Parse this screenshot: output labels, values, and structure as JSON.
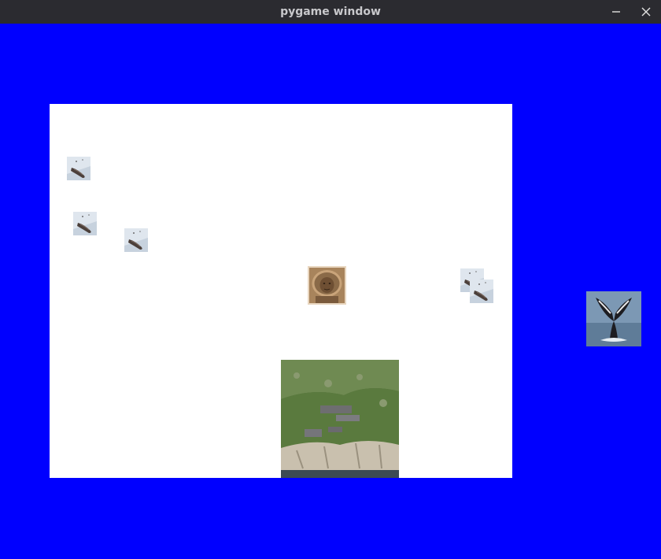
{
  "window": {
    "title": "pygame window",
    "background_color": "#0000ff",
    "titlebar_color": "#2b2b30"
  },
  "titlebar": {
    "minimize_icon": "minimize-icon",
    "close_icon": "close-icon"
  },
  "scene": {
    "panel_color": "#ffffff",
    "sprites": [
      {
        "kind": "seal-on-ice"
      },
      {
        "kind": "seal-on-ice"
      },
      {
        "kind": "seal-on-ice"
      },
      {
        "kind": "seal-on-ice"
      },
      {
        "kind": "seal-on-ice"
      },
      {
        "kind": "sepia-portrait"
      },
      {
        "kind": "island-cliff"
      },
      {
        "kind": "whale-tail"
      }
    ]
  }
}
